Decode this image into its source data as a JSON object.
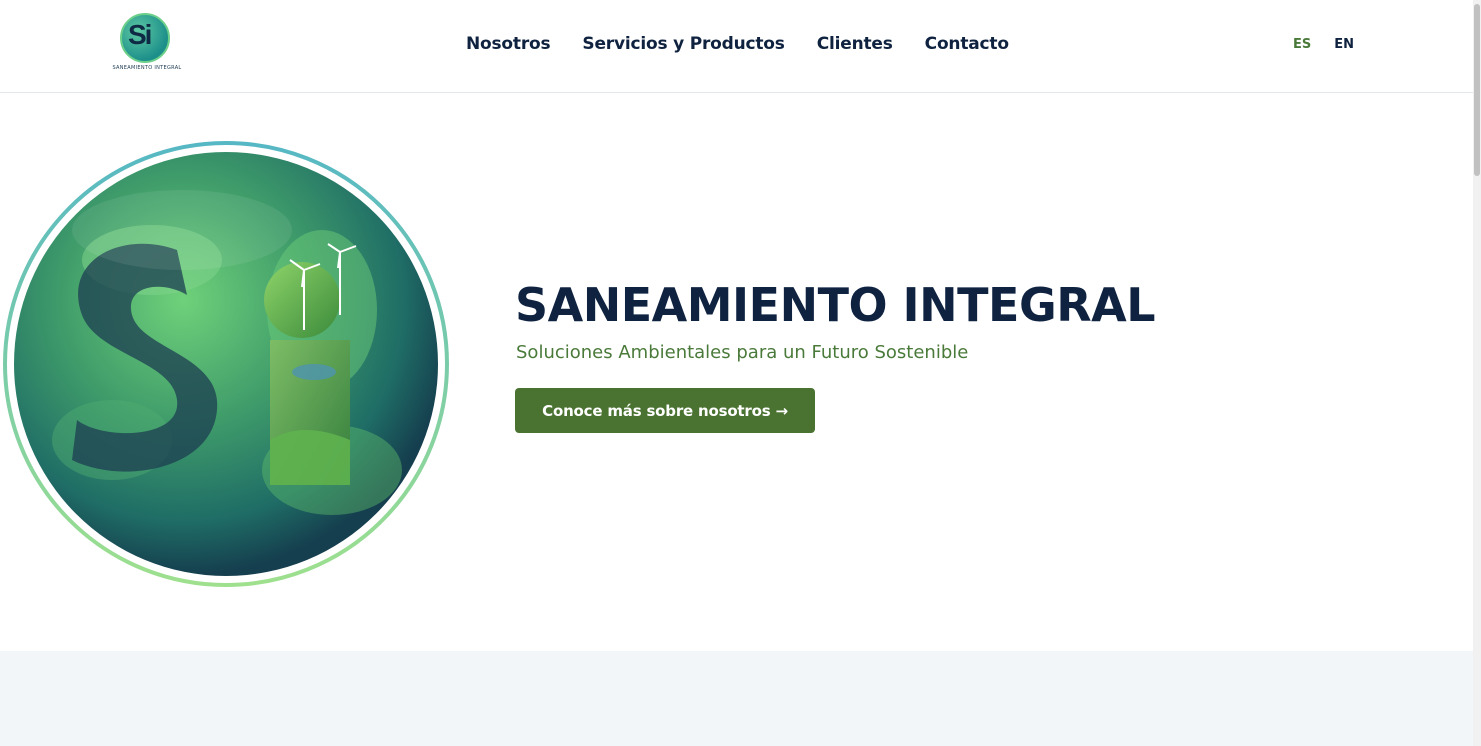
{
  "brand": {
    "logo_letters": "Si",
    "logo_text": "SANEAMIENTO INTEGRAL"
  },
  "nav": {
    "items": [
      {
        "label": "Nosotros"
      },
      {
        "label": "Servicios y Productos"
      },
      {
        "label": "Clientes"
      },
      {
        "label": "Contacto"
      }
    ]
  },
  "lang": {
    "es": "ES",
    "en": "EN",
    "active": "ES"
  },
  "hero": {
    "title": "SANEAMIENTO INTEGRAL",
    "subtitle": "Soluciones Ambientales para un Futuro Sostenible",
    "cta_label": "Conoce más sobre nosotros →",
    "image_letters": "Si"
  },
  "colors": {
    "navy": "#0f2340",
    "green": "#4a7230",
    "accent_green": "#4a7a3a",
    "section_bg": "#f3f6f9"
  },
  "icons": {
    "hero_image": "globe-si-logo-image",
    "cta_arrow": "arrow-right"
  }
}
